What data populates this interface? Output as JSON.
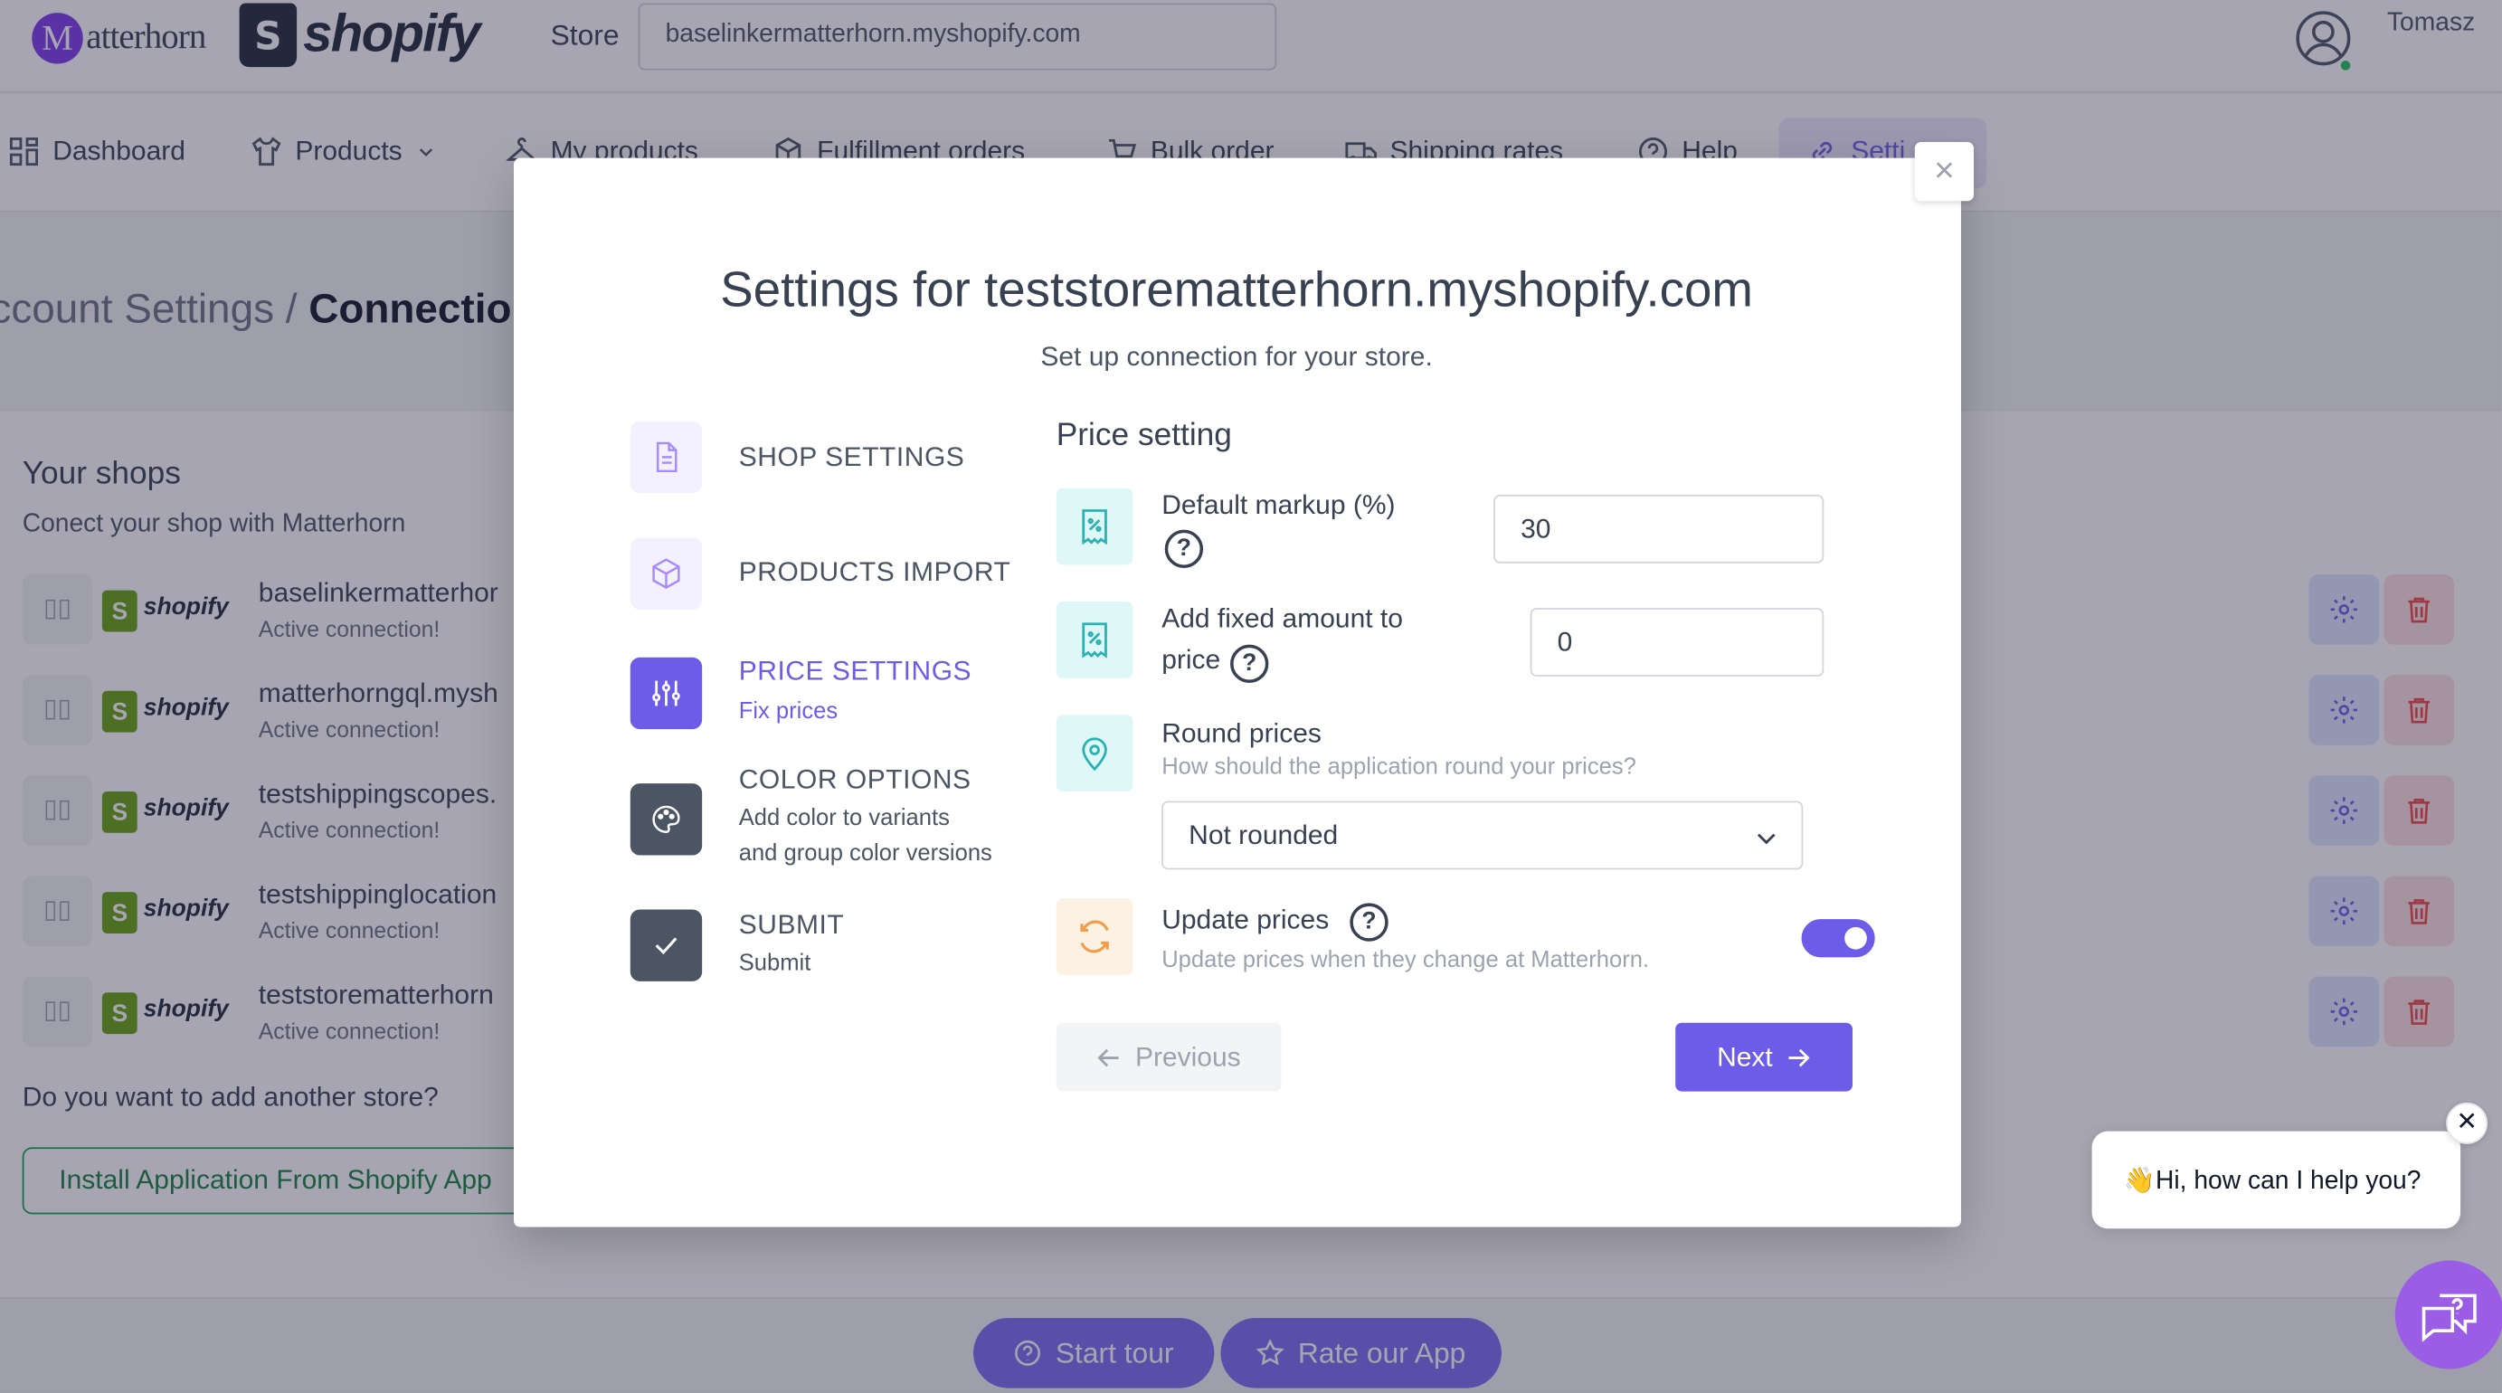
{
  "header": {
    "logo_m": "M",
    "logo_text": "atterhorn",
    "shopify_glyph": "S",
    "shopify_word": "shopify",
    "store_label": "Store",
    "store_value": "baselinkermatterhorn.myshopify.com",
    "user_name": "Tomasz"
  },
  "nav": {
    "items": [
      {
        "label": "Dashboard",
        "icon": "grid-icon"
      },
      {
        "label": "Products",
        "icon": "shirt-icon"
      },
      {
        "label": "My products",
        "icon": "hanger-icon"
      },
      {
        "label": "Fulfillment orders",
        "icon": "package-icon"
      },
      {
        "label": "Bulk order",
        "icon": "cart-icon"
      },
      {
        "label": "Shipping rates",
        "icon": "truck-icon"
      },
      {
        "label": "Help",
        "icon": "help-icon"
      },
      {
        "label": "Setti",
        "icon": "link-icon"
      }
    ]
  },
  "page": {
    "breadcrumb_parent": "ccount Settings / ",
    "breadcrumb_current": "Connectio",
    "shops_title": "Your shops",
    "shops_subtitle": "Conect your shop with Matterhorn",
    "shop_platform_glyph": "S",
    "shop_platform_word": "shopify",
    "drag_handle_glyph": "▯▯",
    "shops": [
      {
        "name": "baselinkermatterhor",
        "status": "Active connection!"
      },
      {
        "name": "matterhorngql.mysh",
        "status": "Active connection!"
      },
      {
        "name": "testshippingscopes.",
        "status": "Active connection!"
      },
      {
        "name": "testshippinglocation",
        "status": "Active connection!"
      },
      {
        "name": "teststorematterhorn",
        "status": "Active connection!"
      }
    ],
    "add_question": "Do you want to add another store?",
    "install_button": "Install Application From Shopify App"
  },
  "bottom": {
    "start_tour": "Start tour",
    "rate_app": "Rate our App"
  },
  "modal": {
    "close_glyph": "×",
    "title": "Settings for teststorematterhorn.myshopify.com",
    "subtitle": "Set up connection for your store.",
    "steps": [
      {
        "title": "SHOP SETTINGS",
        "desc": "",
        "icon": "document-icon",
        "state": "inactive"
      },
      {
        "title": "PRODUCTS IMPORT",
        "desc": "",
        "icon": "cube-icon",
        "state": "inactive"
      },
      {
        "title": "PRICE SETTINGS",
        "desc": "Fix prices",
        "icon": "sliders-icon",
        "state": "active"
      },
      {
        "title": "COLOR OPTIONS",
        "desc_line1": "Add color to variants",
        "desc_line2": "and group color versions",
        "icon": "palette-icon",
        "state": "completed"
      },
      {
        "title": "SUBMIT",
        "desc": "Submit",
        "icon": "check-icon",
        "state": "completed"
      }
    ],
    "section_title": "Price setting",
    "help_glyph": "?",
    "fields": {
      "markup_label": "Default markup (%)",
      "markup_value": "30",
      "fixed_label_line1": "Add fixed amount to",
      "fixed_label_line2": "price",
      "fixed_value": "0",
      "round_label": "Round prices",
      "round_hint": "How should the application round your prices?",
      "round_selected": "Not rounded",
      "update_label": "Update prices",
      "update_hint": "Update prices when they change at Matterhorn.",
      "update_enabled": true
    },
    "prev_button": "Previous",
    "next_button": "Next"
  },
  "chat": {
    "greeting_emoji": "👋",
    "greeting": "Hi, how can I help you?",
    "close_glyph": "✕"
  },
  "colors": {
    "accent": "#6d5ce8",
    "accent_light": "#ede9fe",
    "teal_icon_bg": "#e0f7f7",
    "teal": "#2bb3b3",
    "orange_icon_bg": "#fdf1e4",
    "orange": "#f29d49",
    "completed_step": "#4b5563",
    "danger_bg": "#fee2e2",
    "success": "#16a34a"
  }
}
